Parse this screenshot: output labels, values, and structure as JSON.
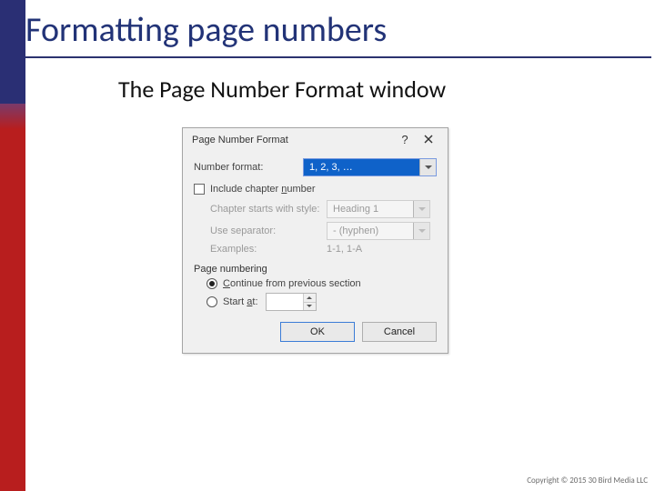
{
  "slide": {
    "title": "Formatting page numbers",
    "subtitle": "The Page Number Format window",
    "copyright": "Copyright © 2015 30 Bird Media LLC"
  },
  "dialog": {
    "title": "Page Number Format",
    "help_symbol": "?",
    "number_format_label": "Number format:",
    "number_format_value": "1, 2, 3, …",
    "include_chapter_label_pre": "Include chapter ",
    "include_chapter_label_u": "n",
    "include_chapter_label_post": "umber",
    "chapter_style_label": "Chapter starts with style:",
    "chapter_style_value": "Heading 1",
    "separator_label": "Use separator:",
    "separator_value": "-   (hyphen)",
    "examples_label": "Examples:",
    "examples_value": "1-1, 1-A",
    "page_numbering_label": "Page numbering",
    "continue_label_u": "C",
    "continue_label_post": "ontinue from previous section",
    "start_at_label_pre": "Start ",
    "start_at_label_u": "a",
    "start_at_label_post": "t:",
    "start_at_value": "",
    "ok_label": "OK",
    "cancel_label": "Cancel"
  }
}
